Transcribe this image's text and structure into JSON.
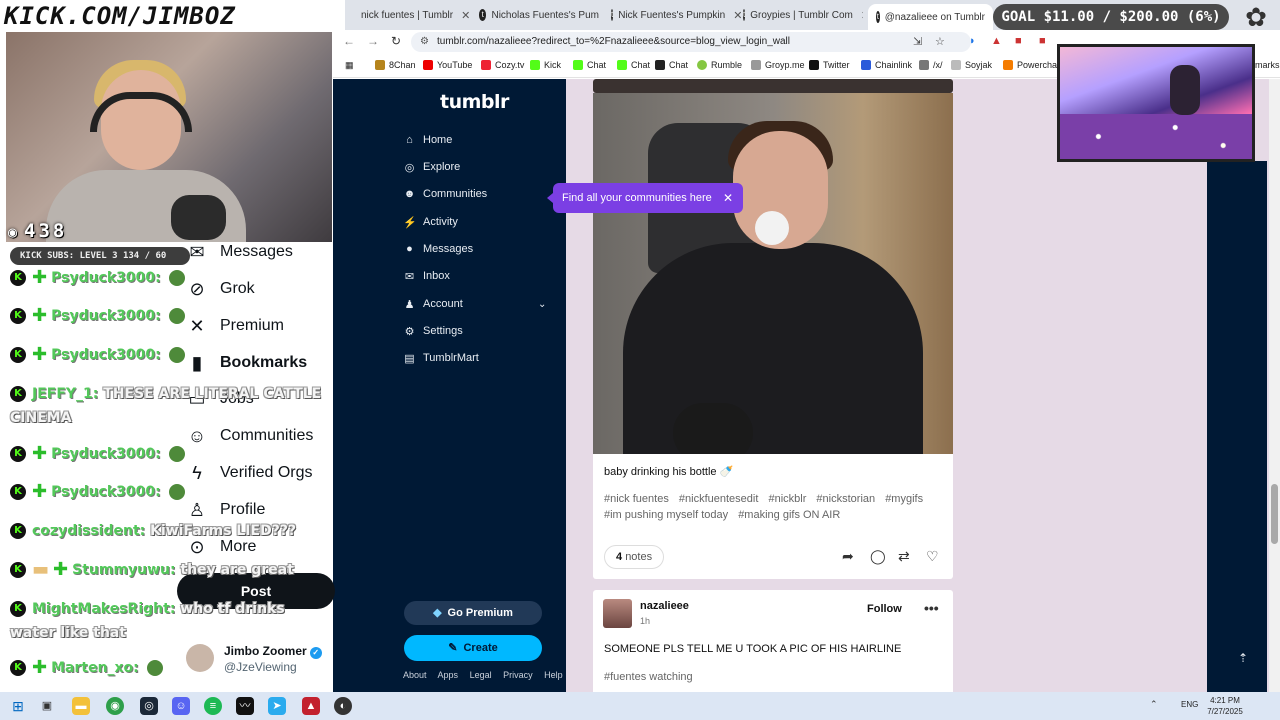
{
  "overlay": {
    "title": "KICK.COM/JIMBOZ",
    "viewer_count": "438",
    "kick_subs": "KICK SUBS: LEVEL 3 134 / 60",
    "goal": "GOAL $11.00 / $200.00 (6%)"
  },
  "chat": [
    {
      "user": "Psyduck3000:",
      "text": ""
    },
    {
      "user": "Psyduck3000:",
      "text": ""
    },
    {
      "user": "Psyduck3000:",
      "text": ""
    },
    {
      "user": "JEFFY_1:",
      "text": "THESE ARE LITERAL CATTLE CINEMA"
    },
    {
      "user": "Psyduck3000:",
      "text": ""
    },
    {
      "user": "Psyduck3000:",
      "text": ""
    },
    {
      "user": "cozydissident:",
      "text": "KiwiFarms LIED???"
    },
    {
      "user": "Stummyuwu:",
      "text": "they are great"
    },
    {
      "user": "MightMakesRight:",
      "text": "who tf drinks water like that"
    },
    {
      "user": "Marten_xo:",
      "text": ""
    }
  ],
  "x_sidebar": {
    "items": [
      "Messages",
      "Grok",
      "Premium",
      "Bookmarks",
      "Jobs",
      "Communities",
      "Verified Orgs",
      "Profile",
      "More"
    ],
    "post_label": "Post",
    "profile_name": "Jimbo Zoomer",
    "profile_handle": "@JzeViewing"
  },
  "browser": {
    "tabs": [
      {
        "label": "nick fuentes | Tumblr"
      },
      {
        "label": "Nicholas Fuentes's Pum"
      },
      {
        "label": "Nick Fuentes's Pumpkin"
      },
      {
        "label": "Groypies | Tumblr Com"
      },
      {
        "label": "@nazalieee on Tumblr"
      }
    ],
    "url": "tumblr.com/nazalieee?redirect_to=%2Fnazalieee&source=blog_view_login_wall",
    "bookmarks": [
      "8Chan",
      "YouTube",
      "Cozy.tv",
      "Kick",
      "Chat",
      "Chat",
      "Chat",
      "Rumble",
      "Groyp.me",
      "Twitter",
      "Chainlink",
      "/x/",
      "Soyjak",
      "Powerchat",
      "marks"
    ]
  },
  "tumblr": {
    "logo": "tumblr",
    "nav": [
      "Home",
      "Explore",
      "Communities",
      "Activity",
      "Messages",
      "Inbox",
      "Account",
      "Settings",
      "TumblrMart"
    ],
    "tooltip": "Find all your communities here",
    "premium_label": "Go Premium",
    "create_label": "Create",
    "footer": [
      "About",
      "Apps",
      "Legal",
      "Privacy",
      "Help"
    ],
    "post": {
      "caption": "baby drinking his bottle 🍼",
      "tags": [
        "#nick fuentes",
        "#nickfuentesedit",
        "#nickblr",
        "#nickstorian",
        "#mygifs",
        "#im pushing myself today",
        "#making gifs ON AIR"
      ],
      "notes_count": "4",
      "notes_label": "notes"
    },
    "post2": {
      "blog_name": "nazalieee",
      "time": "1h",
      "follow_label": "Follow",
      "text": "SOMEONE PLS TELL ME U TOOK A PIC OF HIS HAIRLINE",
      "tag": "#fuentes watching"
    }
  },
  "taskbar": {
    "lang": "ENG",
    "time": "4:21 PM",
    "date": "7/27/2025"
  },
  "colors": {
    "tumblr_navy": "#001935",
    "tumblr_accent": "#00b8ff",
    "tooltip_purple": "#7b3fe4",
    "chat_green": "#53c85a"
  }
}
